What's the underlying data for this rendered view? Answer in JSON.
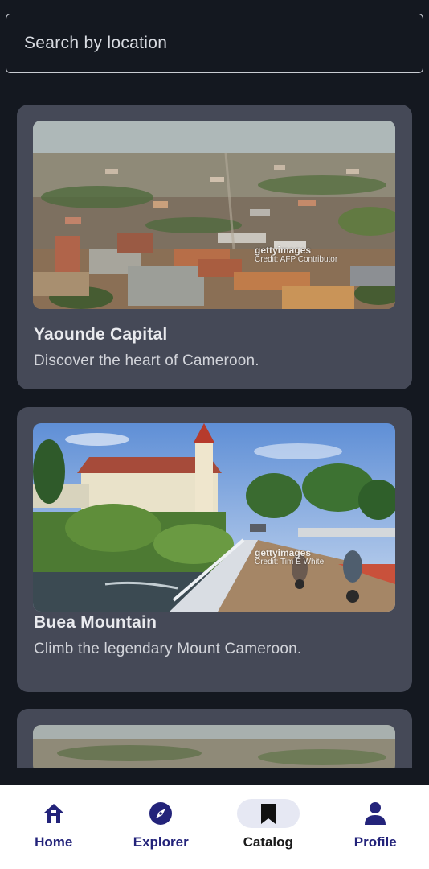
{
  "search": {
    "placeholder": "Search by location",
    "value": ""
  },
  "cards": [
    {
      "title": "Yaounde Capital",
      "description": "Discover the heart of Cameroon.",
      "image_watermark": "gettyimages",
      "image_credit": "Credit: AFP Contributor"
    },
    {
      "title": "Buea Mountain",
      "description": "Climb the legendary Mount Cameroon.",
      "image_watermark": "gettyimages",
      "image_credit": "Credit: Tim E White"
    }
  ],
  "nav": {
    "items": [
      {
        "label": "Home",
        "icon": "home-icon"
      },
      {
        "label": "Explorer",
        "icon": "compass-icon"
      },
      {
        "label": "Catalog",
        "icon": "bookmark-icon"
      },
      {
        "label": "Profile",
        "icon": "person-icon"
      }
    ],
    "active": "Catalog"
  },
  "colors": {
    "background": "#141820",
    "card": "#454957",
    "nav_accent": "#23237a",
    "nav_active_pill": "#e6e8f3"
  }
}
